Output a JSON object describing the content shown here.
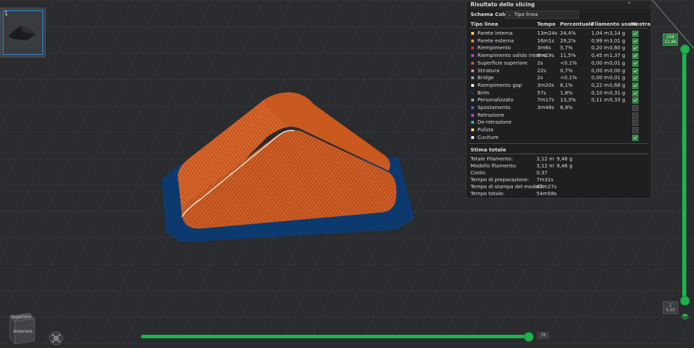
{
  "thumbnail": {
    "plate_number": "1"
  },
  "panel": {
    "title": "Risultato dello slicing",
    "color_scheme_label": "Schema Colore",
    "color_scheme_value": "Tipo linea",
    "headers": {
      "type": "Tipo linea",
      "time": "Tempo",
      "percent": "Percentuale",
      "filament": "Filamento usato",
      "show": "Mostra"
    },
    "rows": [
      {
        "name": "Parete interna",
        "color": "#f3d33a",
        "time": "13m24s",
        "pct": "24,4%",
        "fm": "1,04 m",
        "fg": "3,14 g",
        "show": true
      },
      {
        "name": "Parete esterna",
        "color": "#f28c2a",
        "time": "16m1s",
        "pct": "29,2%",
        "fm": "0,99 m",
        "fg": "3,01 g",
        "show": true
      },
      {
        "name": "Riempimento",
        "color": "#b3383d",
        "time": "3m6s",
        "pct": "5,7%",
        "fm": "0,20 m",
        "fg": "0,60 g",
        "show": true
      },
      {
        "name": "Riempimento solido interno",
        "color": "#9a4fc0",
        "time": "6m19s",
        "pct": "11,5%",
        "fm": "0,45 m",
        "fg": "1,37 g",
        "show": true
      },
      {
        "name": "Superficie superiore",
        "color": "#e04848",
        "time": "2s",
        "pct": "<0.1%",
        "fm": "0,00 m",
        "fg": "0,01 g",
        "show": true
      },
      {
        "name": "Stiratura",
        "color": "#f08a6a",
        "time": "22s",
        "pct": "0,7%",
        "fm": "0,00 m",
        "fg": "0,00 g",
        "show": true
      },
      {
        "name": "Bridge",
        "color": "#7fa6c8",
        "time": "2s",
        "pct": "<0.1%",
        "fm": "0,00 m",
        "fg": "0,01 g",
        "show": true
      },
      {
        "name": "Riempimento gap",
        "color": "#ffffff",
        "time": "3m20s",
        "pct": "6,1%",
        "fm": "0,22 m",
        "fg": "0,68 g",
        "show": true
      },
      {
        "name": "Brim",
        "color": "#0d3a6e",
        "time": "57s",
        "pct": "1,8%",
        "fm": "0,10 m",
        "fg": "0,31 g",
        "show": true
      },
      {
        "name": "Personalizzato",
        "color": "#5fc08a",
        "time": "7m17s",
        "pct": "13,3%",
        "fm": "0,11 m",
        "fg": "0,33 g",
        "show": true
      },
      {
        "name": "Spostamento",
        "color": "#4a5bc8",
        "time": "3m48s",
        "pct": "6,9%",
        "fm": "",
        "fg": "",
        "show": false
      },
      {
        "name": "Retrazione",
        "color": "#c03fc8",
        "time": "",
        "pct": "",
        "fm": "",
        "fg": "",
        "show": false
      },
      {
        "name": "De-retrazione",
        "color": "#3fa9e0",
        "time": "",
        "pct": "",
        "fm": "",
        "fg": "",
        "show": false
      },
      {
        "name": "Pulizia",
        "color": "#f2e23a",
        "time": "",
        "pct": "",
        "fm": "",
        "fg": "",
        "show": false
      },
      {
        "name": "Cuciture",
        "color": "#f0f0f0",
        "time": "",
        "pct": "",
        "fm": "",
        "fg": "",
        "show": true
      }
    ],
    "totals_title": "Stima totale",
    "totals": [
      {
        "label": "Totale Filamento:",
        "v1": "3,12 m",
        "v2": "9,46 g"
      },
      {
        "label": "Modello filamento:",
        "v1": "3,12 m",
        "v2": "9,46 g"
      },
      {
        "label": "Costo:",
        "v1": "0,37",
        "v2": ""
      },
      {
        "label": "Tempo di preparazione:",
        "v1": "7m31s",
        "v2": ""
      },
      {
        "label": "Tempo di stampa del modello:",
        "v1": "47m27s",
        "v2": ""
      },
      {
        "label": "Tempo totale:",
        "v1": "54m58s",
        "v2": ""
      }
    ]
  },
  "viewcube": {
    "top_label": "Superiore",
    "front_label": "Anteriore"
  },
  "horizontal_slider": {
    "value_label": "78",
    "fraction": 0.985
  },
  "vertical_slider": {
    "top_label": "259",
    "top_sub": "51.86",
    "bottom_label": "1",
    "bottom_sub": "0.20",
    "fraction": 1.0
  },
  "colors": {
    "accent": "#1fb14e",
    "model": "#d9652a",
    "brim": "#0d3a6e",
    "bed": "#2a2b2e"
  }
}
